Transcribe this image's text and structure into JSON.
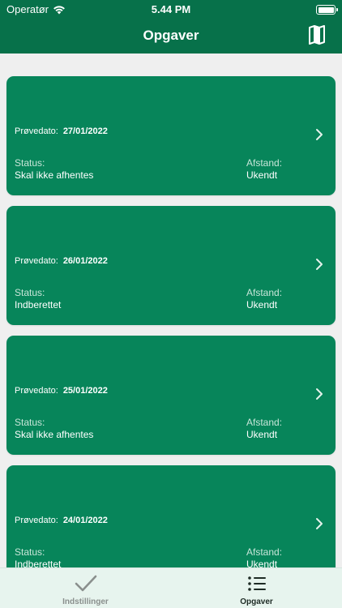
{
  "status_bar": {
    "carrier": "Operatør",
    "time": "5.44 PM"
  },
  "nav": {
    "title": "Opgaver",
    "map_icon": "map-icon"
  },
  "tasks": [
    {
      "date_label": "Prøvedato:",
      "date": "27/01/2022",
      "status_label": "Status:",
      "status": "Skal ikke afhentes",
      "distance_label": "Afstand:",
      "distance": "Ukendt"
    },
    {
      "date_label": "Prøvedato:",
      "date": "26/01/2022",
      "status_label": "Status:",
      "status": "Indberettet",
      "distance_label": "Afstand:",
      "distance": "Ukendt"
    },
    {
      "date_label": "Prøvedato:",
      "date": "25/01/2022",
      "status_label": "Status:",
      "status": "Skal ikke afhentes",
      "distance_label": "Afstand:",
      "distance": "Ukendt"
    },
    {
      "date_label": "Prøvedato:",
      "date": "24/01/2022",
      "status_label": "Status:",
      "status": "Indberettet",
      "distance_label": "Afstand:",
      "distance": "Ukendt"
    }
  ],
  "tab_bar": {
    "items": [
      {
        "label": "Indstillinger",
        "icon": "checkmark-icon",
        "selected": false
      },
      {
        "label": "Opgaver",
        "icon": "list-icon",
        "selected": true
      }
    ]
  },
  "colors": {
    "header": "#07714a",
    "card": "#07855a",
    "background": "#efefef",
    "tab_bar": "#e6f4ee"
  }
}
